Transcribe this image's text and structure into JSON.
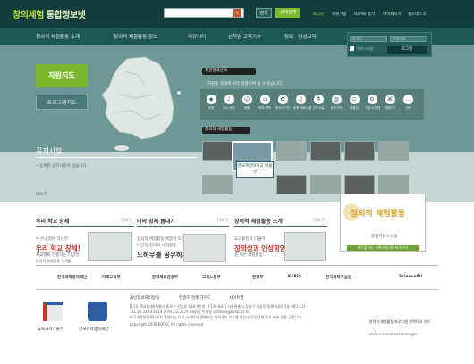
{
  "header": {
    "logo": "창의체험",
    "logo_rest": " 통합정보넷",
    "search": {
      "placeholder": "",
      "icon": "search-icon",
      "button": "검색",
      "detail_button": "상세검색"
    },
    "user_links": [
      "로그인",
      "회원가입",
      "ID/PW 찾기",
      "마이페이지",
      "헬프데스크"
    ]
  },
  "nav": [
    "창의적 체험활동 소개",
    "창의적 체험활동 정보",
    "커뮤니티",
    "선학연 교육기부",
    "창의 · 인성교육"
  ],
  "login": {
    "id_placeholder": "아이디",
    "pw_placeholder": "비밀번호",
    "save_id": "아이디저장",
    "button": "로그인"
  },
  "left_tabs": {
    "active": "자원지도",
    "inactive": "프로그램지도"
  },
  "notice": {
    "title": "공지사항",
    "empty": "• 등록된 공지사항이 없습니다.",
    "more": "더보기"
  },
  "resource_type": {
    "title": "자원형태선택",
    "desc": "자원을 형태에 따라 정렬하여 볼 수 있습니다.",
    "items": [
      {
        "label": "전체",
        "icon": "all-icon"
      },
      {
        "label": "전시·공연",
        "icon": "exhibit-icon"
      },
      {
        "label": "체험",
        "icon": "experience-icon"
      },
      {
        "label": "학교·대학",
        "icon": "school-icon"
      },
      {
        "label": "청소년기관",
        "icon": "youth-icon"
      },
      {
        "label": "문화·체육시설",
        "icon": "culture-icon"
      },
      {
        "label": "연구시설",
        "icon": "research-icon"
      },
      {
        "label": "공공기관",
        "icon": "public-icon"
      },
      {
        "label": "박물관",
        "icon": "museum-icon"
      },
      {
        "label": "기업·산업체",
        "icon": "industry-icon"
      },
      {
        "label": "체험단지",
        "icon": "complex-icon"
      },
      {
        "label": "기타",
        "icon": "etc-icon"
      }
    ]
  },
  "activities": {
    "title": "창의적 체험활동",
    "tooltip": "한국해양대학교 박물관"
  },
  "sections": {
    "school": {
      "title": "우리 학교 창체",
      "more": "더보기",
      "l1": "누구나 참여 가능한",
      "big": "우리 학교 창체!",
      "l2": "학교별로 진행하는 다양한",
      "l3": "창의적 체험활동 사례를",
      "l4": "공유해 보세요."
    },
    "mine": {
      "title": "나의 창체 뽐내기",
      "more": "더보기",
      "l1": "창의적 체험활동 체험기 또는",
      "l2": "나만의 창의적 체험활동",
      "l3": "노하우를 공유하세요."
    },
    "intro": {
      "title": "창의적 체험활동 소개",
      "more": "더보기",
      "l1": "교과활동과 더불어",
      "big": "창의성과 인성함양",
      "l2": "을 위한 체험활동."
    }
  },
  "banner": {
    "title": "창의적 체험활동",
    "sub": "종합지원시스템",
    "button": "포트폴리오 기록(에듀팟) 바로가기"
  },
  "partners": [
    "한국과학창의재단",
    "미래교육부",
    "문화체육관광부",
    "교육노동부",
    "환경부",
    "KERIS",
    "한국과학기술원",
    "ScienceAll"
  ],
  "footer": {
    "links": [
      "개인정보처리방침",
      "컨텐츠 관계 가이드",
      "사이트맵"
    ],
    "addr1": "[110-763] 서울특별시 종로구 연건동 128-9번지 | [139-847] 서울특별시 강남구 역삼로 509 (대치 3동 960-12)",
    "addr2": "TEL.02.2174.6614 | FAX.02.2174.6603 | 이메일 crezone@kofac.or.kr",
    "addr3": "한국과학창의재단에서 운영하는 모든 사이트의 콘텐츠는 저작권의 보호를 받는바 무단전재,복사 배포 등을 금합니다.",
    "copy": "copyright 2009 KOFAC All rights reserved",
    "org1": "교육과학기술부",
    "org2": "한국과학창의재단",
    "right_title": "창의적 체험활동 프로그램 컨텍트와 가기",
    "right_url": "www.crezone.net/manager"
  }
}
